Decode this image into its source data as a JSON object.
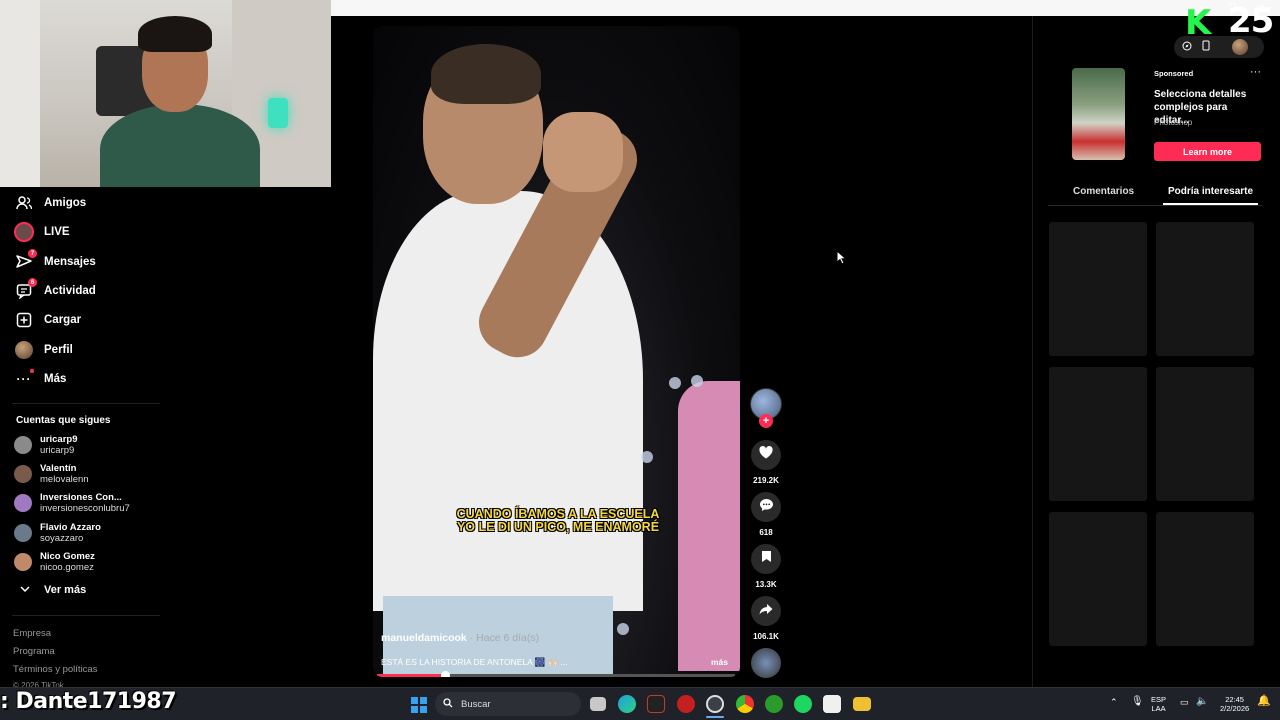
{
  "nav": {
    "items": [
      {
        "label": "Amigos",
        "icon": "friends-icon"
      },
      {
        "label": "LIVE",
        "icon": "live-icon"
      },
      {
        "label": "Mensajes",
        "icon": "messages-icon",
        "badge": "7"
      },
      {
        "label": "Actividad",
        "icon": "activity-icon",
        "badge": "6"
      },
      {
        "label": "Cargar",
        "icon": "upload-icon"
      },
      {
        "label": "Perfil",
        "icon": "profile-icon"
      },
      {
        "label": "Más",
        "icon": "more-icon"
      }
    ],
    "following_title": "Cuentas que sigues",
    "following": [
      {
        "name": "uricarp9",
        "handle": "uricarp9",
        "color": "#8a8a8a"
      },
      {
        "name": "Valentín",
        "handle": "melovalenn",
        "color": "#7a5a4a"
      },
      {
        "name": "Inversiones  Con...",
        "handle": "inversionesconlubru7",
        "color": "#a07ac0"
      },
      {
        "name": "Flavio Azzaro",
        "handle": "soyazzaro",
        "color": "#6a7a8a"
      },
      {
        "name": "Nico Gomez",
        "handle": "nicoo.gomez",
        "color": "#c08a6a"
      }
    ],
    "see_more": "Ver más",
    "footer": [
      "Empresa",
      "Programa",
      "Términos y políticas"
    ],
    "copyright": "© 2026 TikTok"
  },
  "video": {
    "watermark": "@manueldamicook",
    "caption_line1": "CUANDO ÍBAMOS A LA ESCUELA",
    "caption_line2": "YO LE DI UN PICO, ME ENAMORÉ",
    "author": "manueldamicook",
    "time": " · Hace 6 día(s)",
    "description": "ESTÁ ES LA HISTORIA DE ANTONELA 🎆 🙌🏻 ...",
    "more": "más",
    "progress": 0.19
  },
  "actions": {
    "likes": "219.2K",
    "comments": "618",
    "saves": "13.3K",
    "shares": "106.1K"
  },
  "right_panel": {
    "brand_number": "25",
    "ad": {
      "sponsored": "Sponsored",
      "title": "Selecciona detalles complejos para editar...",
      "brand": "Photoshop",
      "cta": "Learn more"
    },
    "tabs": [
      "Comentarios",
      "Podría interesarte"
    ]
  },
  "taskbar": {
    "overlay_name": ": Dante171987",
    "search_placeholder": "Buscar",
    "lang_top": "ESP",
    "lang_bottom": "LAA",
    "time": "22:45",
    "date": "2/2/2026"
  },
  "colors": {
    "accent": "#fe2c55",
    "brand_green": "#25f44a"
  }
}
